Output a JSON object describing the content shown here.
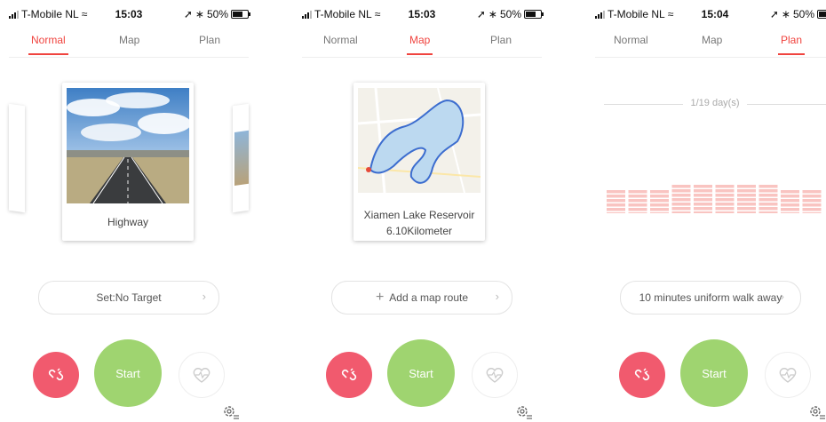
{
  "status": {
    "carrier": "T-Mobile NL",
    "battery": "50%"
  },
  "screens": [
    {
      "time": "15:03",
      "tabs": [
        "Normal",
        "Map",
        "Plan"
      ],
      "active_tab": 0,
      "card": {
        "title": "Highway"
      },
      "target": {
        "label": "Set:No Target"
      },
      "start": "Start"
    },
    {
      "time": "15:03",
      "tabs": [
        "Normal",
        "Map",
        "Plan"
      ],
      "active_tab": 1,
      "card": {
        "title": "Xiamen Lake Reservoir",
        "distance": "6.10Kilometer"
      },
      "route": {
        "plus": "+",
        "label": "Add a map route"
      },
      "start": "Start"
    },
    {
      "time": "15:04",
      "tabs": [
        "Normal",
        "Map",
        "Plan"
      ],
      "active_tab": 2,
      "plan": {
        "days": "1/19 day(s)",
        "bar_count": 10
      },
      "target": {
        "label": "10 minutes uniform walk away"
      },
      "start": "Start"
    }
  ],
  "colors": {
    "accent": "#f0443f",
    "start": "#9fd470",
    "stop": "#f15a6e",
    "bars": "#f9c4c1"
  },
  "icons": {
    "signal": "signal-icon",
    "wifi": "wifi-icon",
    "location": "location-arrow-icon",
    "bluetooth": "bluetooth-icon",
    "battery": "battery-icon",
    "stop": "broken-link-icon",
    "heart": "heart-rate-icon",
    "gear": "gear-settings-icon"
  }
}
